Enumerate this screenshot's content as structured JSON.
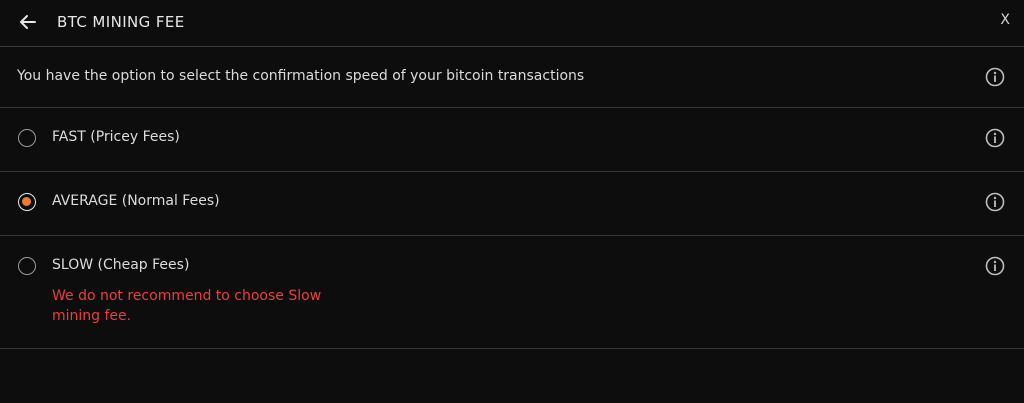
{
  "header": {
    "title": "BTC MINING FEE",
    "back_icon": "arrow-left-icon",
    "close_label": "X"
  },
  "intro": {
    "text": "You have the option to select the confirmation speed of your bitcoin transactions",
    "icon": "info-icon"
  },
  "options": [
    {
      "label": "FAST (Pricey Fees)",
      "selected": false,
      "icon": "info-icon"
    },
    {
      "label": "AVERAGE (Normal Fees)",
      "selected": true,
      "icon": "info-icon"
    },
    {
      "label": "SLOW (Cheap Fees)",
      "selected": false,
      "icon": "info-icon",
      "warning": "We do not recommend to choose Slow mining fee."
    }
  ],
  "colors": {
    "background": "#0d0d0e",
    "accent": "#f37a2b",
    "warning": "#ef3d3d",
    "divider": "#3a3a3c"
  }
}
